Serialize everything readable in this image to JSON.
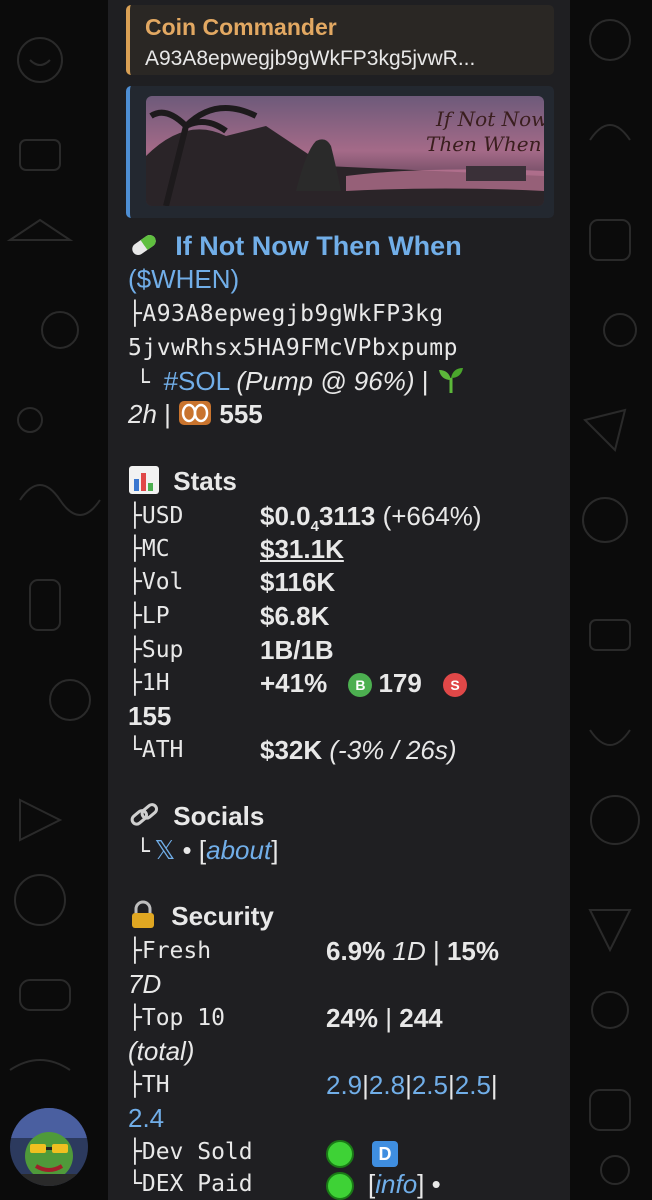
{
  "reply": {
    "name": "Coin Commander",
    "text": "A93A8epwegjb9gWkFP3kg5jvwR..."
  },
  "preview": {
    "image_text_1": "If Not Now",
    "image_text_2": "Then When"
  },
  "header": {
    "title": "If Not Now Then When",
    "ticker": "($WHEN)",
    "ca_1": "A93A8epwegjb9gWkFP3kg",
    "ca_2": "5jvwRhsx5HA9FMcVPbxpump",
    "chain": "#SOL",
    "pump": "(Pump @ 96%)",
    "sep": " | ",
    "age": "2h",
    "sep2": " | ",
    "views": "555",
    "tree_branch": "├",
    "tree_end": "└"
  },
  "stats": {
    "heading": "Stats",
    "rows": [
      {
        "label": "├USD",
        "value": "$0.0",
        "sub": "4",
        "value_rest": "3113",
        "extra": " (+664%)"
      },
      {
        "label": "├MC",
        "value": "$31.1K"
      },
      {
        "label": "├Vol",
        "value": "$116K"
      },
      {
        "label": "├LP",
        "value": "$6.8K"
      },
      {
        "label": "├Sup",
        "value": "1B/1B"
      },
      {
        "label": "├1H",
        "value": "+41%",
        "buys": "179",
        "buy_badge": "B",
        "sell_badge": "S"
      },
      {
        "label": "└ATH",
        "value": "$32K",
        "extra": " (-3% / 26s)"
      }
    ],
    "sells": "155"
  },
  "socials": {
    "heading": "Socials",
    "tree": "└",
    "x_label": "𝕏",
    "bullet": " • ",
    "about": "about",
    "open_bracket": "[",
    "close_bracket": "]"
  },
  "security": {
    "heading": "Security",
    "fresh_label": "├Fresh",
    "fresh_1d": "6.9%",
    "fresh_1d_unit": " 1D",
    "fresh_sep": " | ",
    "fresh_7d": "15%",
    "fresh_7d_unit": "7D",
    "top10_label": "├Top 10",
    "top10_pct": "24%",
    "top10_sep": " | ",
    "top10_count": "244",
    "top10_total": "(total)",
    "th_label": "├TH",
    "th_values": [
      "2.9",
      "2.8",
      "2.5",
      "2.5"
    ],
    "th_last": "2.4",
    "th_sep": "|",
    "dev_label": "├Dev Sold",
    "dev_badge": "D",
    "dex_label": "└DEX Paid",
    "info": "info",
    "dex_bullet": " •"
  },
  "colors": {
    "accent_blue": "#71aee8",
    "reply_orange": "#e2a862",
    "green": "#3ed236",
    "buy_green": "#4caf50",
    "sell_red": "#e04848"
  },
  "icons": [
    "pill-icon",
    "chart-icon",
    "link-icon",
    "lock-icon",
    "seedling-icon",
    "eyes-icon"
  ]
}
